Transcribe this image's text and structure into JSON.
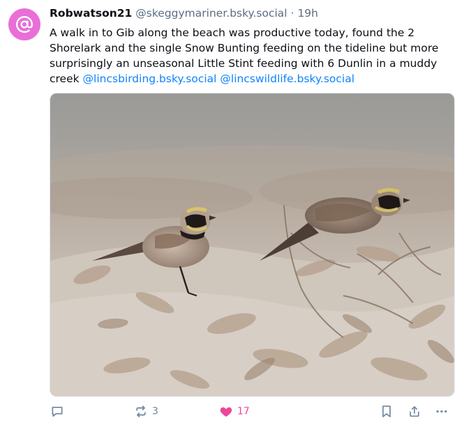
{
  "post": {
    "author_name": "Robwatson21",
    "author_handle": "@skeggymariner.bsky.social",
    "separator": "·",
    "time_ago": "19h",
    "text_main": "A walk in to Gib along the beach was productive today, found the 2 Shorelark and the single Snow Bunting feeding on the tideline but more surprisingly an unseasonal Little Stint feeding with 6 Dunlin in a muddy creek ",
    "mentions": [
      "@lincsbirding.bsky.social",
      "@lincswildlife.bsky.social"
    ],
    "image_alt": "Two Shorelarks on a beach among dried leaves"
  },
  "actions": {
    "reply_count": "",
    "repost_count": "3",
    "like_count": "17"
  },
  "icons": {
    "avatar": "at-sign-icon",
    "reply": "speech-bubble-icon",
    "repost": "repost-arrows-icon",
    "like": "heart-icon",
    "bookmark": "bookmark-icon",
    "share": "share-icon",
    "more": "ellipsis-icon"
  },
  "colors": {
    "avatar_bg": "#e86fd8",
    "mention": "#1083fe",
    "like": "#ec4899",
    "muted": "#6f869f"
  }
}
